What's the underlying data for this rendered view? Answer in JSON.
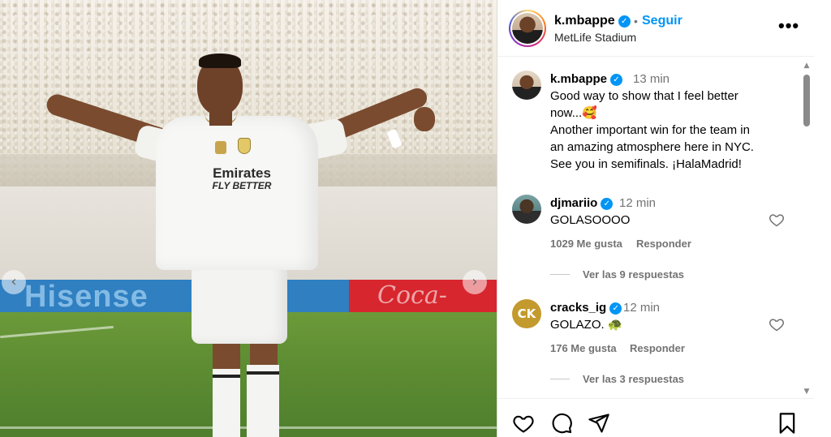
{
  "media": {
    "ad_board_left": "Hisense",
    "ad_board_right": "Coca-Cola",
    "sponsor_line1": "Emirates",
    "sponsor_line2": "FLY BETTER",
    "prev_icon": "‹",
    "next_icon": "›"
  },
  "header": {
    "username": "k.mbappe",
    "verified_icon": "✓",
    "separator": "•",
    "follow_label": "Seguir",
    "location": "MetLife Stadium",
    "more_icon": "•••"
  },
  "caption": {
    "username": "k.mbappe",
    "verified_icon": "✓",
    "time": "13 min",
    "lines": [
      "Good way to show that I feel better",
      "now...🥰",
      "Another important win for the team in",
      "an amazing atmosphere here in NYC.",
      "See you in semifinals. ¡HalaMadrid!"
    ]
  },
  "comments": [
    {
      "username": "djmariio",
      "verified_icon": "✓",
      "time": "12 min",
      "text": "GOLASOOOO",
      "likes": "1029 Me gusta",
      "reply_label": "Responder",
      "view_replies": "Ver las 9 respuestas"
    },
    {
      "username": "cracks_ig",
      "avatar_text": "CK",
      "verified_icon": "✓",
      "time": "12 min",
      "text": "GOLAZO. 🐢",
      "likes": "176 Me gusta",
      "reply_label": "Responder",
      "view_replies": "Ver las 3 respuestas"
    }
  ],
  "scrollbar": {
    "up_icon": "▲",
    "down_icon": "▼"
  }
}
